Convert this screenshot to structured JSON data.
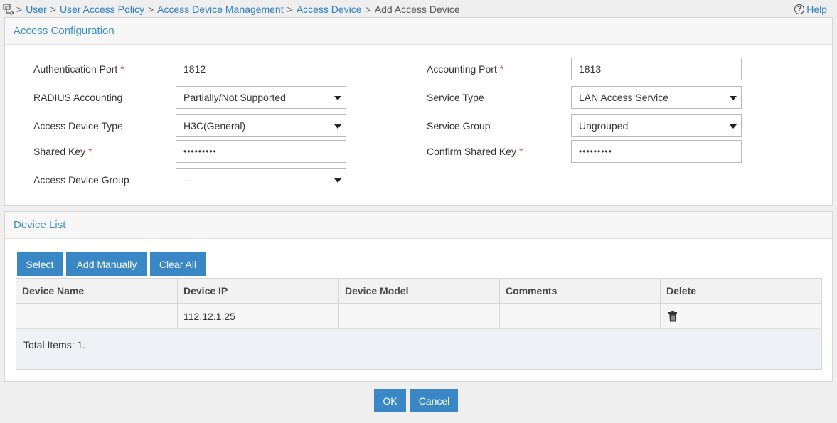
{
  "breadcrumb": {
    "items": [
      {
        "label": "User",
        "link": true
      },
      {
        "label": "User Access Policy",
        "link": true
      },
      {
        "label": "Access Device Management",
        "link": true
      },
      {
        "label": "Access Device",
        "link": true
      },
      {
        "label": "Add Access Device",
        "link": false
      }
    ],
    "separator": ">",
    "help_label": "Help",
    "help_icon": "?"
  },
  "access_config": {
    "title": "Access Configuration",
    "auth_port": {
      "label": "Authentication Port",
      "required": "*",
      "value": "1812"
    },
    "acct_port": {
      "label": "Accounting Port",
      "required": "*",
      "value": "1813"
    },
    "radius_accounting": {
      "label": "RADIUS Accounting",
      "value": "Partially/Not Supported"
    },
    "service_type": {
      "label": "Service Type",
      "value": "LAN Access Service"
    },
    "device_type": {
      "label": "Access Device Type",
      "value": "H3C(General)"
    },
    "service_group": {
      "label": "Service Group",
      "value": "Ungrouped"
    },
    "shared_key": {
      "label": "Shared Key",
      "required": "*",
      "value": "•••••••••"
    },
    "confirm_key": {
      "label": "Confirm Shared Key",
      "required": "*",
      "value": "•••••••••"
    },
    "device_group": {
      "label": "Access Device Group",
      "value": "--"
    }
  },
  "device_list": {
    "title": "Device List",
    "buttons": {
      "select": "Select",
      "add_manually": "Add Manually",
      "clear_all": "Clear All"
    },
    "columns": [
      "Device Name",
      "Device IP",
      "Device Model",
      "Comments",
      "Delete"
    ],
    "rows": [
      {
        "name": "",
        "ip": "112.12.1.25",
        "model": "",
        "comments": ""
      }
    ],
    "total": "Total Items: 1."
  },
  "footer": {
    "ok": "OK",
    "cancel": "Cancel"
  },
  "colors": {
    "accent": "#3a87c6",
    "link": "#2e7fbf",
    "required": "#d9534f"
  }
}
